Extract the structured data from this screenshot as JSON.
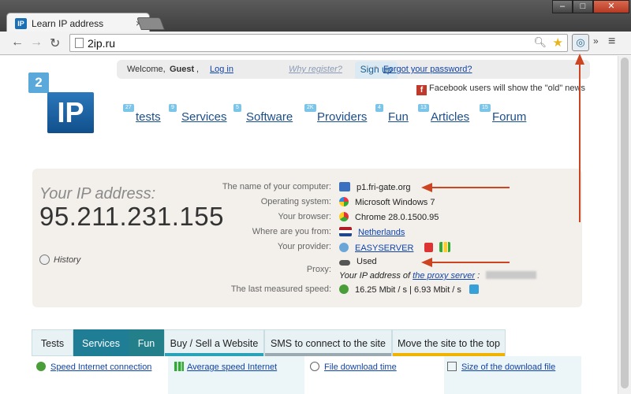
{
  "browser": {
    "tab_title": "Learn IP address",
    "tab_favicon": "IP",
    "url": "2ip.ru"
  },
  "login": {
    "welcome": "Welcome,",
    "user": "Guest",
    "login": "Log in",
    "signup": "Sign up",
    "register": "Why register?",
    "forgot": "Forgot your password?"
  },
  "facebook_note": "Facebook users will show the \"old\" news",
  "logo": {
    "top": "2",
    "main": "IP"
  },
  "nav": [
    {
      "badge": "27",
      "label": "tests"
    },
    {
      "badge": "9",
      "label": "Services"
    },
    {
      "badge": "5",
      "label": "Software"
    },
    {
      "badge": "2K",
      "label": "Providers"
    },
    {
      "badge": "4",
      "label": "Fun"
    },
    {
      "badge": "13",
      "label": "Articles"
    },
    {
      "badge": "15",
      "label": "Forum"
    }
  ],
  "ip": {
    "label": "Your IP address:",
    "value": "95.211.231.155",
    "history": "History"
  },
  "info": {
    "computer_name_label": "The name of your computer:",
    "computer_name": "p1.fri-gate.org",
    "os_label": "Operating system:",
    "os": "Microsoft Windows 7",
    "browser_label": "Your browser:",
    "browser": "Chrome 28.0.1500.95",
    "location_label": "Where are you from:",
    "location": "Netherlands",
    "provider_label": "Your provider:",
    "provider": "EASYSERVER",
    "proxy_label": "Proxy:",
    "proxy": "Used",
    "proxy_sub": "Your IP address of",
    "proxy_link": "the proxy server",
    "speed_label": "The last measured speed:",
    "speed": "16.25 Mbit / s | 6.93 Mbit / s"
  },
  "page_tabs": [
    {
      "label": "Tests"
    },
    {
      "label": "Services"
    },
    {
      "label": "Fun"
    },
    {
      "label": "Buy / Sell a Website"
    },
    {
      "label": "SMS to connect to the site"
    },
    {
      "label": "Move the site to the top"
    }
  ],
  "sub_links": [
    "Speed Internet connection",
    "Average speed Internet",
    "File download time",
    "Size of the download file"
  ],
  "colors": {
    "accent": "#1f7e95",
    "arrow": "#cc4422",
    "link": "#1144aa"
  }
}
